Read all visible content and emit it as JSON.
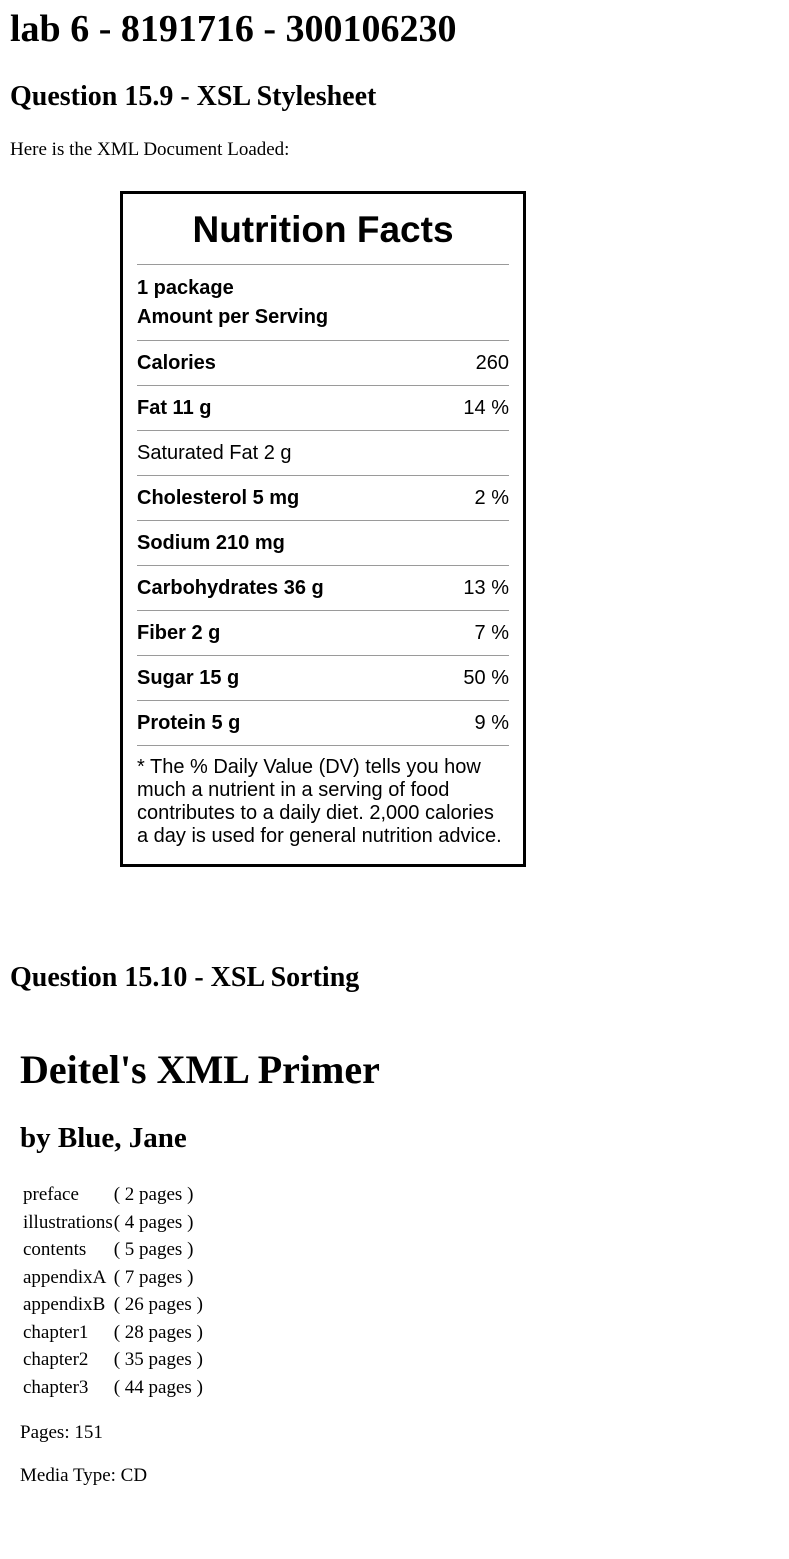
{
  "page_title": "lab 6 - 8191716 - 300106230",
  "q1_heading": "Question 15.9 - XSL Stylesheet",
  "intro_text": "Here is the XML Document Loaded:",
  "nutrition": {
    "title": "Nutrition Facts",
    "serving_size": "1 package",
    "amount_per_serving": "Amount per Serving",
    "rows": [
      {
        "name": "Calories",
        "value": "260"
      },
      {
        "name": "Fat 11 g",
        "value": "14 %"
      },
      {
        "name": "Saturated Fat 2 g",
        "value": ""
      },
      {
        "name": "Cholesterol 5 mg",
        "value": "2 %"
      },
      {
        "name": "Sodium 210 mg",
        "value": ""
      },
      {
        "name": "Carbohydrates 36 g",
        "value": "13 %"
      },
      {
        "name": "Fiber 2 g",
        "value": "7 %"
      },
      {
        "name": "Sugar 15 g",
        "value": "50 %"
      },
      {
        "name": "Protein 5 g",
        "value": "9 %"
      }
    ],
    "footnote": "* The % Daily Value (DV) tells you how much a nutrient in a serving of food contributes to a daily diet. 2,000 calories a day is used for general nutrition advice."
  },
  "q2_heading": "Question 15.10 - XSL Sorting",
  "book": {
    "title": "Deitel's XML Primer",
    "author": "by Blue, Jane",
    "chapters": [
      {
        "name": "preface",
        "pages": "( 2 pages )"
      },
      {
        "name": "illustrations",
        "pages": "( 4 pages )"
      },
      {
        "name": "contents",
        "pages": "( 5 pages )"
      },
      {
        "name": "appendixA",
        "pages": "( 7 pages )"
      },
      {
        "name": "appendixB",
        "pages": "( 26 pages )"
      },
      {
        "name": "chapter1",
        "pages": "( 28 pages )"
      },
      {
        "name": "chapter2",
        "pages": "( 35 pages )"
      },
      {
        "name": "chapter3",
        "pages": "( 44 pages )"
      }
    ],
    "pages_line": "Pages: 151",
    "media_line": "Media Type: CD"
  }
}
